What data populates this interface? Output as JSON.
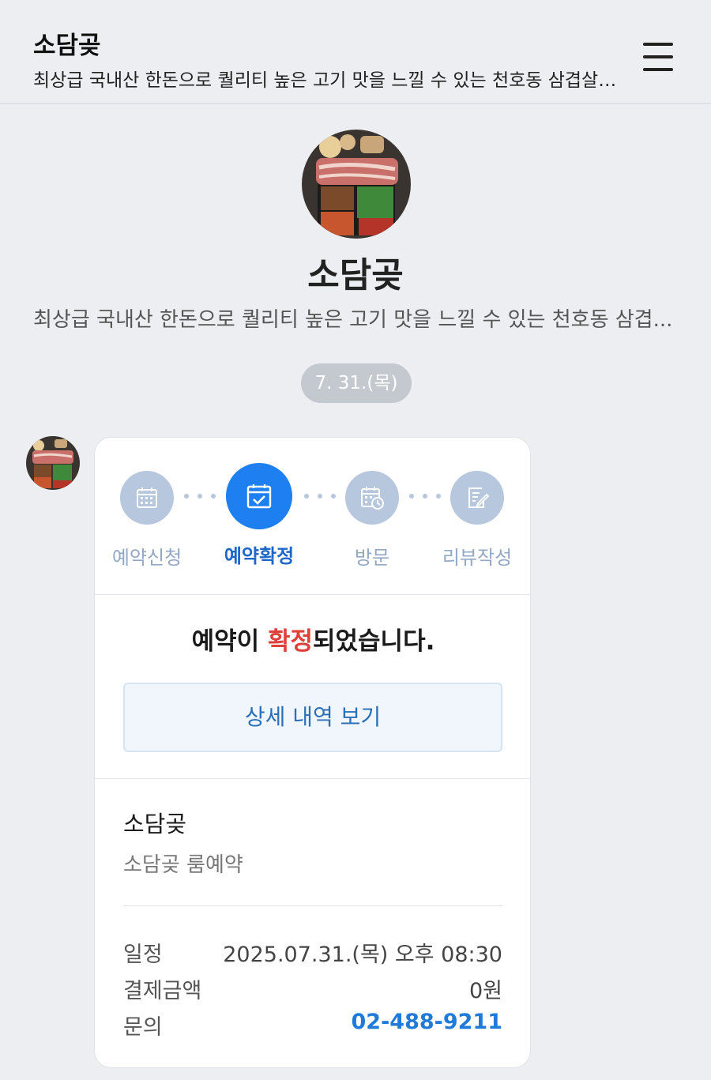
{
  "header": {
    "title": "소담곶",
    "subtitle": "최상급 국내산 한돈으로 퀄리티 높은 고기 맛을 느낄 수 있는 천호동 삼겹살 맛..."
  },
  "profile": {
    "name": "소담곶",
    "description": "최상급 국내산 한돈으로 퀄리티 높은 고기 맛을 느낄 수 있는 천호동 삼겹..."
  },
  "date_separator": "7. 31.(목)",
  "steps": [
    {
      "label": "예약신청",
      "icon": "calendar-grid-icon",
      "active": false
    },
    {
      "label": "예약확정",
      "icon": "calendar-check-icon",
      "active": true
    },
    {
      "label": "방문",
      "icon": "calendar-clock-icon",
      "active": false
    },
    {
      "label": "리뷰작성",
      "icon": "edit-note-icon",
      "active": false
    }
  ],
  "confirmation": {
    "prefix": "예약이 ",
    "highlight": "확정",
    "suffix": "되었습니다."
  },
  "detail_button": "상세 내역 보기",
  "reservation": {
    "shop": "소담곶",
    "product": "소담곶 룸예약",
    "rows": [
      {
        "key": "일정",
        "value": "2025.07.31.(목) 오후 08:30"
      },
      {
        "key": "결제금액",
        "value": "0원"
      },
      {
        "key": "문의",
        "value": "02-488-9211"
      }
    ]
  },
  "colors": {
    "accent": "#1e7ff0",
    "highlight_red": "#e0403a",
    "inactive_step": "#b6c7de",
    "link": "#1f7ad9"
  }
}
